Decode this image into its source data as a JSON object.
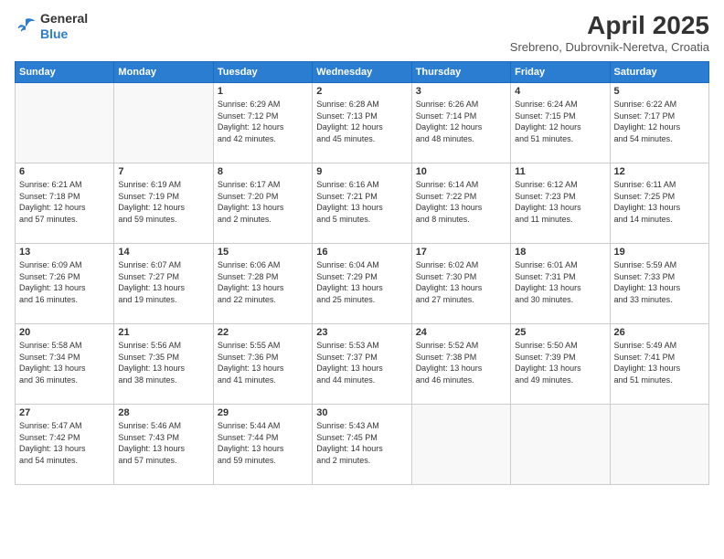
{
  "header": {
    "logo": {
      "line1": "General",
      "line2": "Blue"
    },
    "title": "April 2025",
    "location": "Srebreno, Dubrovnik-Neretva, Croatia"
  },
  "weekdays": [
    "Sunday",
    "Monday",
    "Tuesday",
    "Wednesday",
    "Thursday",
    "Friday",
    "Saturday"
  ],
  "weeks": [
    [
      {
        "day": "",
        "info": ""
      },
      {
        "day": "",
        "info": ""
      },
      {
        "day": "1",
        "info": "Sunrise: 6:29 AM\nSunset: 7:12 PM\nDaylight: 12 hours\nand 42 minutes."
      },
      {
        "day": "2",
        "info": "Sunrise: 6:28 AM\nSunset: 7:13 PM\nDaylight: 12 hours\nand 45 minutes."
      },
      {
        "day": "3",
        "info": "Sunrise: 6:26 AM\nSunset: 7:14 PM\nDaylight: 12 hours\nand 48 minutes."
      },
      {
        "day": "4",
        "info": "Sunrise: 6:24 AM\nSunset: 7:15 PM\nDaylight: 12 hours\nand 51 minutes."
      },
      {
        "day": "5",
        "info": "Sunrise: 6:22 AM\nSunset: 7:17 PM\nDaylight: 12 hours\nand 54 minutes."
      }
    ],
    [
      {
        "day": "6",
        "info": "Sunrise: 6:21 AM\nSunset: 7:18 PM\nDaylight: 12 hours\nand 57 minutes."
      },
      {
        "day": "7",
        "info": "Sunrise: 6:19 AM\nSunset: 7:19 PM\nDaylight: 12 hours\nand 59 minutes."
      },
      {
        "day": "8",
        "info": "Sunrise: 6:17 AM\nSunset: 7:20 PM\nDaylight: 13 hours\nand 2 minutes."
      },
      {
        "day": "9",
        "info": "Sunrise: 6:16 AM\nSunset: 7:21 PM\nDaylight: 13 hours\nand 5 minutes."
      },
      {
        "day": "10",
        "info": "Sunrise: 6:14 AM\nSunset: 7:22 PM\nDaylight: 13 hours\nand 8 minutes."
      },
      {
        "day": "11",
        "info": "Sunrise: 6:12 AM\nSunset: 7:23 PM\nDaylight: 13 hours\nand 11 minutes."
      },
      {
        "day": "12",
        "info": "Sunrise: 6:11 AM\nSunset: 7:25 PM\nDaylight: 13 hours\nand 14 minutes."
      }
    ],
    [
      {
        "day": "13",
        "info": "Sunrise: 6:09 AM\nSunset: 7:26 PM\nDaylight: 13 hours\nand 16 minutes."
      },
      {
        "day": "14",
        "info": "Sunrise: 6:07 AM\nSunset: 7:27 PM\nDaylight: 13 hours\nand 19 minutes."
      },
      {
        "day": "15",
        "info": "Sunrise: 6:06 AM\nSunset: 7:28 PM\nDaylight: 13 hours\nand 22 minutes."
      },
      {
        "day": "16",
        "info": "Sunrise: 6:04 AM\nSunset: 7:29 PM\nDaylight: 13 hours\nand 25 minutes."
      },
      {
        "day": "17",
        "info": "Sunrise: 6:02 AM\nSunset: 7:30 PM\nDaylight: 13 hours\nand 27 minutes."
      },
      {
        "day": "18",
        "info": "Sunrise: 6:01 AM\nSunset: 7:31 PM\nDaylight: 13 hours\nand 30 minutes."
      },
      {
        "day": "19",
        "info": "Sunrise: 5:59 AM\nSunset: 7:33 PM\nDaylight: 13 hours\nand 33 minutes."
      }
    ],
    [
      {
        "day": "20",
        "info": "Sunrise: 5:58 AM\nSunset: 7:34 PM\nDaylight: 13 hours\nand 36 minutes."
      },
      {
        "day": "21",
        "info": "Sunrise: 5:56 AM\nSunset: 7:35 PM\nDaylight: 13 hours\nand 38 minutes."
      },
      {
        "day": "22",
        "info": "Sunrise: 5:55 AM\nSunset: 7:36 PM\nDaylight: 13 hours\nand 41 minutes."
      },
      {
        "day": "23",
        "info": "Sunrise: 5:53 AM\nSunset: 7:37 PM\nDaylight: 13 hours\nand 44 minutes."
      },
      {
        "day": "24",
        "info": "Sunrise: 5:52 AM\nSunset: 7:38 PM\nDaylight: 13 hours\nand 46 minutes."
      },
      {
        "day": "25",
        "info": "Sunrise: 5:50 AM\nSunset: 7:39 PM\nDaylight: 13 hours\nand 49 minutes."
      },
      {
        "day": "26",
        "info": "Sunrise: 5:49 AM\nSunset: 7:41 PM\nDaylight: 13 hours\nand 51 minutes."
      }
    ],
    [
      {
        "day": "27",
        "info": "Sunrise: 5:47 AM\nSunset: 7:42 PM\nDaylight: 13 hours\nand 54 minutes."
      },
      {
        "day": "28",
        "info": "Sunrise: 5:46 AM\nSunset: 7:43 PM\nDaylight: 13 hours\nand 57 minutes."
      },
      {
        "day": "29",
        "info": "Sunrise: 5:44 AM\nSunset: 7:44 PM\nDaylight: 13 hours\nand 59 minutes."
      },
      {
        "day": "30",
        "info": "Sunrise: 5:43 AM\nSunset: 7:45 PM\nDaylight: 14 hours\nand 2 minutes."
      },
      {
        "day": "",
        "info": ""
      },
      {
        "day": "",
        "info": ""
      },
      {
        "day": "",
        "info": ""
      }
    ]
  ]
}
